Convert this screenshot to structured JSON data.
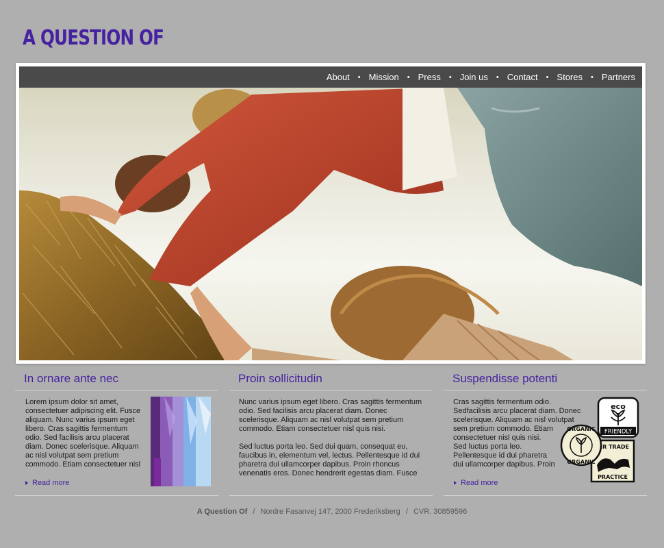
{
  "brand": {
    "logo": "A QUESTION OF"
  },
  "nav": {
    "items": [
      {
        "label": "About"
      },
      {
        "label": "Mission"
      },
      {
        "label": "Press"
      },
      {
        "label": "Join us"
      },
      {
        "label": "Contact"
      },
      {
        "label": "Stores"
      },
      {
        "label": "Partners"
      }
    ],
    "separator": "•"
  },
  "columns": [
    {
      "heading": "In ornare ante nec",
      "lines": [
        "Lorem ipsum dolor sit amet,",
        "consectetuer adipiscing elit. Fusce",
        "aliquam. Nunc varius ipsum eget",
        "libero. Cras sagittis fermentum",
        "odio. Sed facilisis arcu placerat",
        "diam. Donec scelerisque. Aliquam",
        "ac nisl volutpat sem pretium",
        "commodo. Etiam consectetuer nisl"
      ],
      "read_more": "Read more"
    },
    {
      "heading": "Proin sollicitudin",
      "lines": [
        "Nunc varius ipsum eget libero. Cras sagittis fermentum",
        "odio. Sed facilisis arcu placerat diam. Donec",
        "scelerisque. Aliquam ac nisl volutpat sem pretium",
        "commodo. Etiam consectetuer nisl quis nisi.",
        "",
        "Sed luctus porta leo. Sed dui quam, consequat eu,",
        "faucibus in, elementum vel, lectus. Pellentesque id dui",
        "pharetra dui ullamcorper dapibus. Proin rhoncus",
        "venenatis eros. Donec hendrerit egestas diam. Fusce"
      ]
    },
    {
      "heading": "Suspendisse potenti",
      "lines": [
        "Cras sagittis fermentum odio.",
        "Sedfacilisis arcu placerat diam. Donec",
        "scelerisque. Aliquam ac nisl volutpat",
        "sem pretium commodo. Etiam",
        "consectetuer nisl quis nisi.",
        "Sed luctus porta leo.",
        "Pellentesque id dui pharetra",
        "dui ullamcorper dapibus. Proin"
      ],
      "read_more": "Read more",
      "badges": {
        "eco_top": "eco",
        "eco_bottom": "FRIENDLY",
        "organic": "ORGANIC",
        "fair_top": "AIR TRADE",
        "fair_bottom": "PRACTICE"
      }
    }
  ],
  "footer": {
    "company": "A Question Of",
    "address": "Nordre Fasanvej 147, 2000 Frederiksberg",
    "cvr": "CVR. 30859596",
    "separator": "/"
  },
  "colors": {
    "background": "#afafaf",
    "accent": "#4622a0",
    "navbar": "#4a4a4a"
  }
}
